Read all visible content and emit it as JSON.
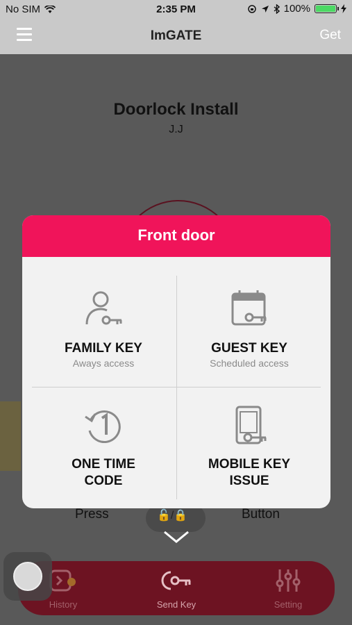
{
  "status_bar": {
    "carrier": "No SIM",
    "time": "2:35 PM",
    "battery": "100%"
  },
  "nav": {
    "title": "ImGATE",
    "right_label": "Get"
  },
  "background": {
    "title": "Doorlock Install",
    "subtitle": "J.J",
    "press_label": "Press",
    "button_label": "Button"
  },
  "modal": {
    "title": "Front door",
    "options": [
      {
        "label": "FAMILY KEY",
        "desc": "Aways access",
        "icon": "person-key-icon"
      },
      {
        "label": "GUEST KEY",
        "desc": "Scheduled access",
        "icon": "calendar-key-icon"
      },
      {
        "label": "ONE TIME\nCODE",
        "desc": "",
        "icon": "one-time-icon"
      },
      {
        "label": "MOBILE KEY\nISSUE",
        "desc": "",
        "icon": "phone-key-icon"
      }
    ]
  },
  "tabbar": {
    "items": [
      {
        "label": "History",
        "icon": "history-icon"
      },
      {
        "label": "Send Key",
        "icon": "send-key-icon"
      },
      {
        "label": "Setting",
        "icon": "sliders-icon"
      }
    ]
  },
  "colors": {
    "accent": "#f0145a",
    "tabbar": "#6d1322"
  }
}
